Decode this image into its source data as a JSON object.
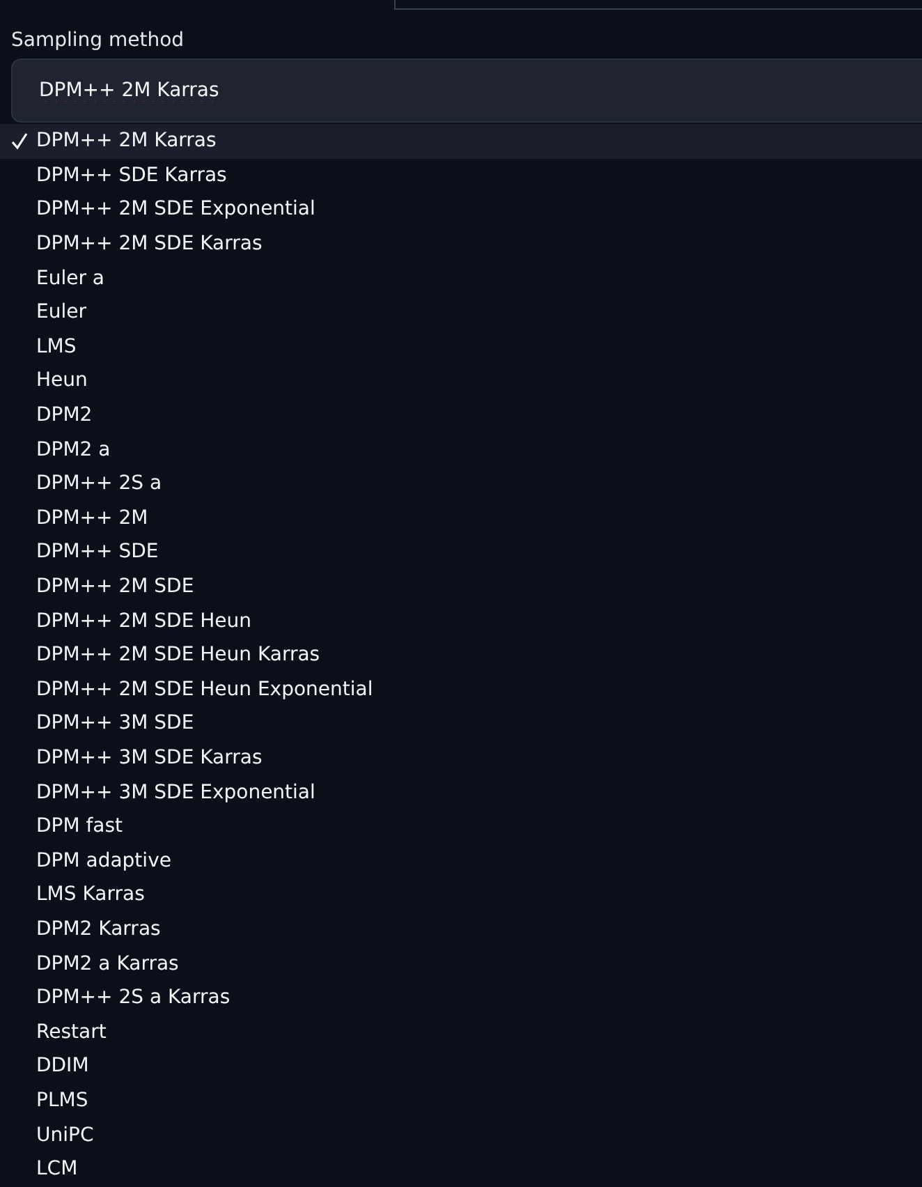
{
  "field": {
    "label": "Sampling method",
    "value": "DPM++ 2M Karras"
  },
  "options": [
    {
      "label": "DPM++ 2M Karras",
      "selected": true
    },
    {
      "label": "DPM++ SDE Karras",
      "selected": false
    },
    {
      "label": "DPM++ 2M SDE Exponential",
      "selected": false
    },
    {
      "label": "DPM++ 2M SDE Karras",
      "selected": false
    },
    {
      "label": "Euler a",
      "selected": false
    },
    {
      "label": "Euler",
      "selected": false
    },
    {
      "label": "LMS",
      "selected": false
    },
    {
      "label": "Heun",
      "selected": false
    },
    {
      "label": "DPM2",
      "selected": false
    },
    {
      "label": "DPM2 a",
      "selected": false
    },
    {
      "label": "DPM++ 2S a",
      "selected": false
    },
    {
      "label": "DPM++ 2M",
      "selected": false
    },
    {
      "label": "DPM++ SDE",
      "selected": false
    },
    {
      "label": "DPM++ 2M SDE",
      "selected": false
    },
    {
      "label": "DPM++ 2M SDE Heun",
      "selected": false
    },
    {
      "label": "DPM++ 2M SDE Heun Karras",
      "selected": false
    },
    {
      "label": "DPM++ 2M SDE Heun Exponential",
      "selected": false
    },
    {
      "label": "DPM++ 3M SDE",
      "selected": false
    },
    {
      "label": "DPM++ 3M SDE Karras",
      "selected": false
    },
    {
      "label": "DPM++ 3M SDE Exponential",
      "selected": false
    },
    {
      "label": "DPM fast",
      "selected": false
    },
    {
      "label": "DPM adaptive",
      "selected": false
    },
    {
      "label": "LMS Karras",
      "selected": false
    },
    {
      "label": "DPM2 Karras",
      "selected": false
    },
    {
      "label": "DPM2 a Karras",
      "selected": false
    },
    {
      "label": "DPM++ 2S a Karras",
      "selected": false
    },
    {
      "label": "Restart",
      "selected": false
    },
    {
      "label": "DDIM",
      "selected": false
    },
    {
      "label": "PLMS",
      "selected": false
    },
    {
      "label": "UniPC",
      "selected": false
    },
    {
      "label": "LCM",
      "selected": false
    }
  ]
}
